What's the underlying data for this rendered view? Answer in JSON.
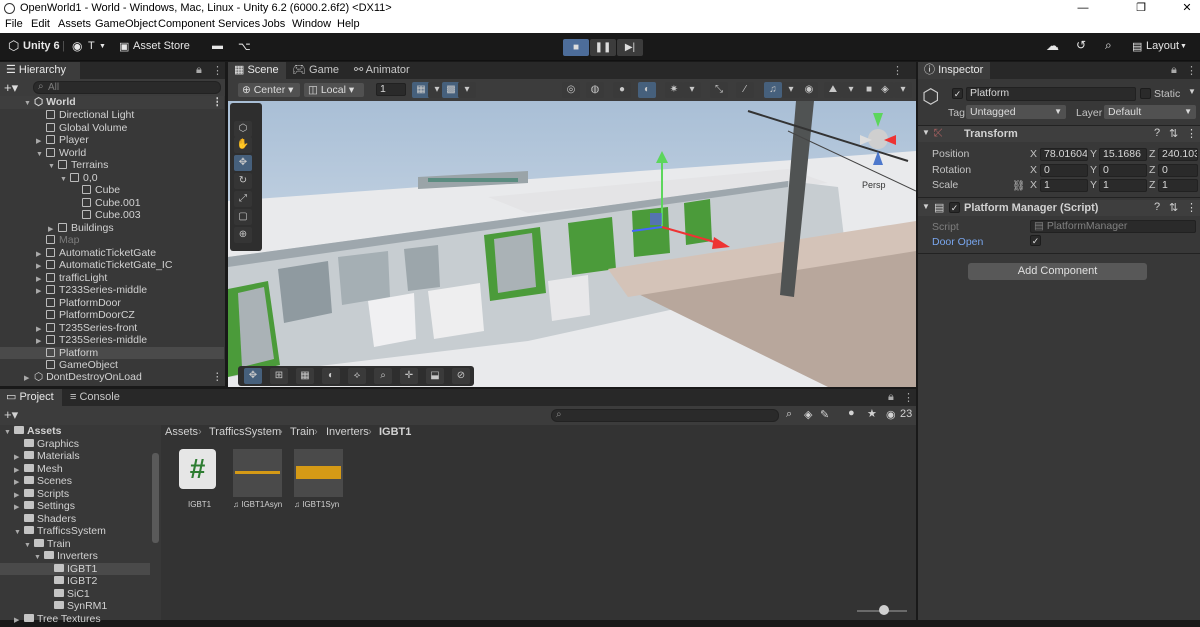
{
  "window": {
    "title": "OpenWorld1 - World - Windows, Mac, Linux - Unity 6.2 (6000.2.6f2) <DX11>",
    "controls": [
      "—",
      "❐",
      "✕"
    ]
  },
  "menu": [
    "File",
    "Edit",
    "Assets",
    "GameObject",
    "Component",
    "Services",
    "Jobs",
    "Window",
    "Help"
  ],
  "toolbar": {
    "unity_label": "Unity 6",
    "account_label": "T",
    "asset_store_label": "Asset Store",
    "layout_label": "Layout"
  },
  "hierarchy": {
    "tab_label": "Hierarchy",
    "search_placeholder": "All",
    "scene_name": "World",
    "items": [
      {
        "label": "Directional Light",
        "depth": 1
      },
      {
        "label": "Global Volume",
        "depth": 1
      },
      {
        "label": "Player",
        "depth": 1,
        "arrow": true
      },
      {
        "label": "World",
        "depth": 1,
        "arrow": true,
        "open": true
      },
      {
        "label": "Terrains",
        "depth": 2,
        "arrow": true,
        "open": true
      },
      {
        "label": "0,0",
        "depth": 3,
        "arrow": true,
        "open": true
      },
      {
        "label": "Cube",
        "depth": 4
      },
      {
        "label": "Cube.001",
        "depth": 4
      },
      {
        "label": "Cube.003",
        "depth": 4
      },
      {
        "label": "Buildings",
        "depth": 2,
        "arrow": true
      },
      {
        "label": "Map",
        "depth": 1,
        "dim": true
      },
      {
        "label": "AutomaticTicketGate",
        "depth": 1,
        "arrow": true
      },
      {
        "label": "AutomaticTicketGate_IC",
        "depth": 1,
        "arrow": true
      },
      {
        "label": "trafficLight",
        "depth": 1,
        "arrow": true
      },
      {
        "label": "T233Series-middle",
        "depth": 1,
        "arrow": true
      },
      {
        "label": "PlatformDoor",
        "depth": 1
      },
      {
        "label": "PlatformDoorCZ",
        "depth": 1
      },
      {
        "label": "T235Series-front",
        "depth": 1,
        "arrow": true
      },
      {
        "label": "T235Series-middle",
        "depth": 1,
        "arrow": true
      },
      {
        "label": "Platform",
        "depth": 1,
        "selected": true
      },
      {
        "label": "GameObject",
        "depth": 1
      }
    ],
    "dontdestroy_label": "DontDestroyOnLoad"
  },
  "scene_tabs": [
    "Scene",
    "Game",
    "Animator"
  ],
  "scene_toolbar": {
    "pivot_label": "Center",
    "space_label": "Local",
    "snap_value": "1",
    "persp_label": "Persp"
  },
  "inspector": {
    "tab_label": "Inspector",
    "object_name": "Platform",
    "static_label": "Static",
    "tag_label": "Tag",
    "tag_value": "Untagged",
    "layer_label": "Layer",
    "layer_value": "Default",
    "transform_title": "Transform",
    "position_label": "Position",
    "rotation_label": "Rotation",
    "scale_label": "Scale",
    "position": {
      "x": "78.01604",
      "y": "15.1686",
      "z": "240.1033"
    },
    "rotation": {
      "x": "0",
      "y": "0",
      "z": "0"
    },
    "scale": {
      "x": "1",
      "y": "1",
      "z": "1"
    },
    "script_component_title": "Platform Manager (Script)",
    "script_label": "Script",
    "script_value": "PlatformManager",
    "door_open_label": "Door Open",
    "door_open_checked": true,
    "add_component_label": "Add Component"
  },
  "project": {
    "tabs": [
      "Project",
      "Console"
    ],
    "tree": [
      {
        "label": "Assets",
        "depth": 0,
        "arrow": true,
        "open": true,
        "bold": true
      },
      {
        "label": "Graphics",
        "depth": 1
      },
      {
        "label": "Materials",
        "depth": 1,
        "arrow": true
      },
      {
        "label": "Mesh",
        "depth": 1,
        "arrow": true
      },
      {
        "label": "Scenes",
        "depth": 1,
        "arrow": true
      },
      {
        "label": "Scripts",
        "depth": 1,
        "arrow": true
      },
      {
        "label": "Settings",
        "depth": 1,
        "arrow": true
      },
      {
        "label": "Shaders",
        "depth": 1
      },
      {
        "label": "TrafficsSystem",
        "depth": 1,
        "arrow": true,
        "open": true
      },
      {
        "label": "Train",
        "depth": 2,
        "arrow": true,
        "open": true
      },
      {
        "label": "Inverters",
        "depth": 3,
        "arrow": true,
        "open": true
      },
      {
        "label": "IGBT1",
        "depth": 4,
        "selected": true
      },
      {
        "label": "IGBT2",
        "depth": 4
      },
      {
        "label": "SiC1",
        "depth": 4
      },
      {
        "label": "SynRM1",
        "depth": 4
      },
      {
        "label": "Tree Textures",
        "depth": 1,
        "arrow": true
      }
    ],
    "breadcrumb": [
      "Assets",
      "TrafficsSystem",
      "Train",
      "Inverters",
      "IGBT1"
    ],
    "assets": [
      {
        "label": "IGBT1",
        "kind": "script"
      },
      {
        "label": "IGBT1Asyn",
        "kind": "audio"
      },
      {
        "label": "IGBT1Syn",
        "kind": "audio"
      }
    ],
    "hidden_count": "23"
  },
  "colors": {
    "accent": "#4d78cc",
    "selection": "#4a4a4a",
    "panel": "#383838",
    "toolbar": "#191919"
  }
}
